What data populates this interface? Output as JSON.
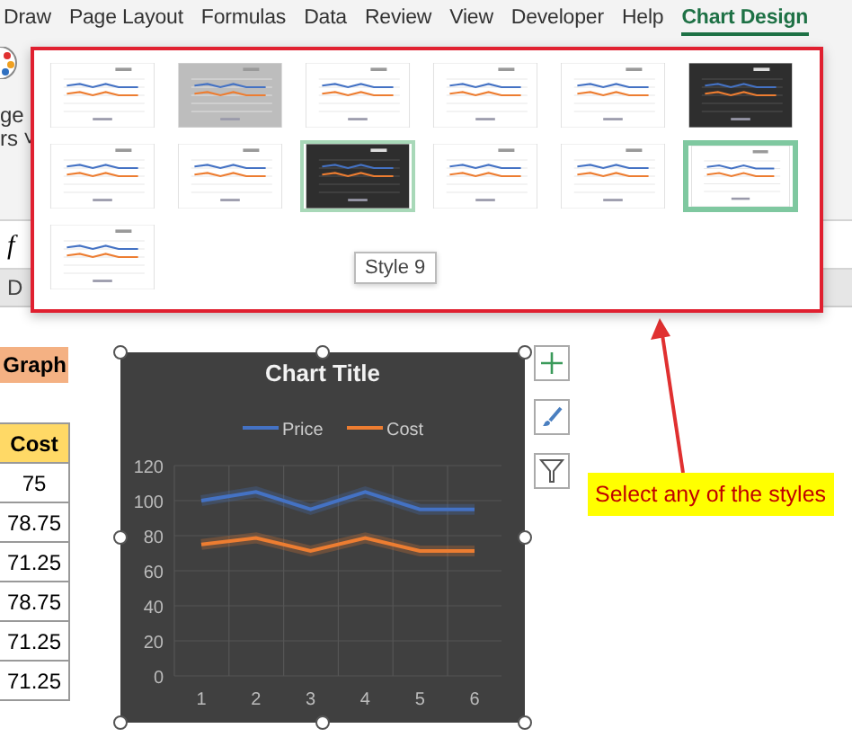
{
  "ribbon_tabs": [
    {
      "label": "Draw",
      "selected": false
    },
    {
      "label": "Page Layout",
      "selected": false
    },
    {
      "label": "Formulas",
      "selected": false
    },
    {
      "label": "Data",
      "selected": false
    },
    {
      "label": "Review",
      "selected": false
    },
    {
      "label": "View",
      "selected": false
    },
    {
      "label": "Developer",
      "selected": false
    },
    {
      "label": "Help",
      "selected": false
    },
    {
      "label": "Chart Design",
      "selected": true
    }
  ],
  "ribbon_button": {
    "label_lines": [
      "ge",
      "rs"
    ],
    "caret": "˅"
  },
  "formula_bar": {
    "fx": "f"
  },
  "column_header": "D",
  "style_gallery": {
    "styles": [
      {
        "kind": "light",
        "selected": false,
        "hovered": false
      },
      {
        "kind": "gray",
        "selected": false,
        "hovered": false
      },
      {
        "kind": "light",
        "selected": false,
        "hovered": false
      },
      {
        "kind": "light",
        "selected": false,
        "hovered": false
      },
      {
        "kind": "light",
        "selected": false,
        "hovered": false
      },
      {
        "kind": "dark",
        "selected": false,
        "hovered": false
      },
      {
        "kind": "light",
        "selected": false,
        "hovered": false
      },
      {
        "kind": "light",
        "selected": false,
        "hovered": false
      },
      {
        "kind": "dark",
        "selected": false,
        "hovered": true
      },
      {
        "kind": "light",
        "selected": false,
        "hovered": false
      },
      {
        "kind": "light",
        "selected": false,
        "hovered": false
      },
      {
        "kind": "light",
        "selected": true,
        "hovered": false
      },
      {
        "kind": "light",
        "selected": false,
        "hovered": false
      }
    ],
    "tooltip": "Style 9"
  },
  "sheet": {
    "title_cell": "Graph",
    "column": {
      "header": "Cost",
      "values": [
        "75",
        "78.75",
        "71.25",
        "78.75",
        "71.25",
        "71.25"
      ]
    }
  },
  "chart": {
    "chart_data": {
      "type": "line",
      "title": "Chart Title",
      "categories": [
        "1",
        "2",
        "3",
        "4",
        "5",
        "6"
      ],
      "series": [
        {
          "name": "Price",
          "color": "#4472c4",
          "values": [
            100,
            105,
            95,
            105,
            95,
            95
          ]
        },
        {
          "name": "Cost",
          "color": "#ed7d31",
          "values": [
            75,
            78.75,
            71.25,
            78.75,
            71.25,
            71.25
          ]
        }
      ],
      "grid": true,
      "legend": true,
      "ylim": [
        0,
        120
      ],
      "yticks": [
        0,
        20,
        40,
        60,
        80,
        100,
        120
      ]
    }
  },
  "callout": "Select any of the styles"
}
